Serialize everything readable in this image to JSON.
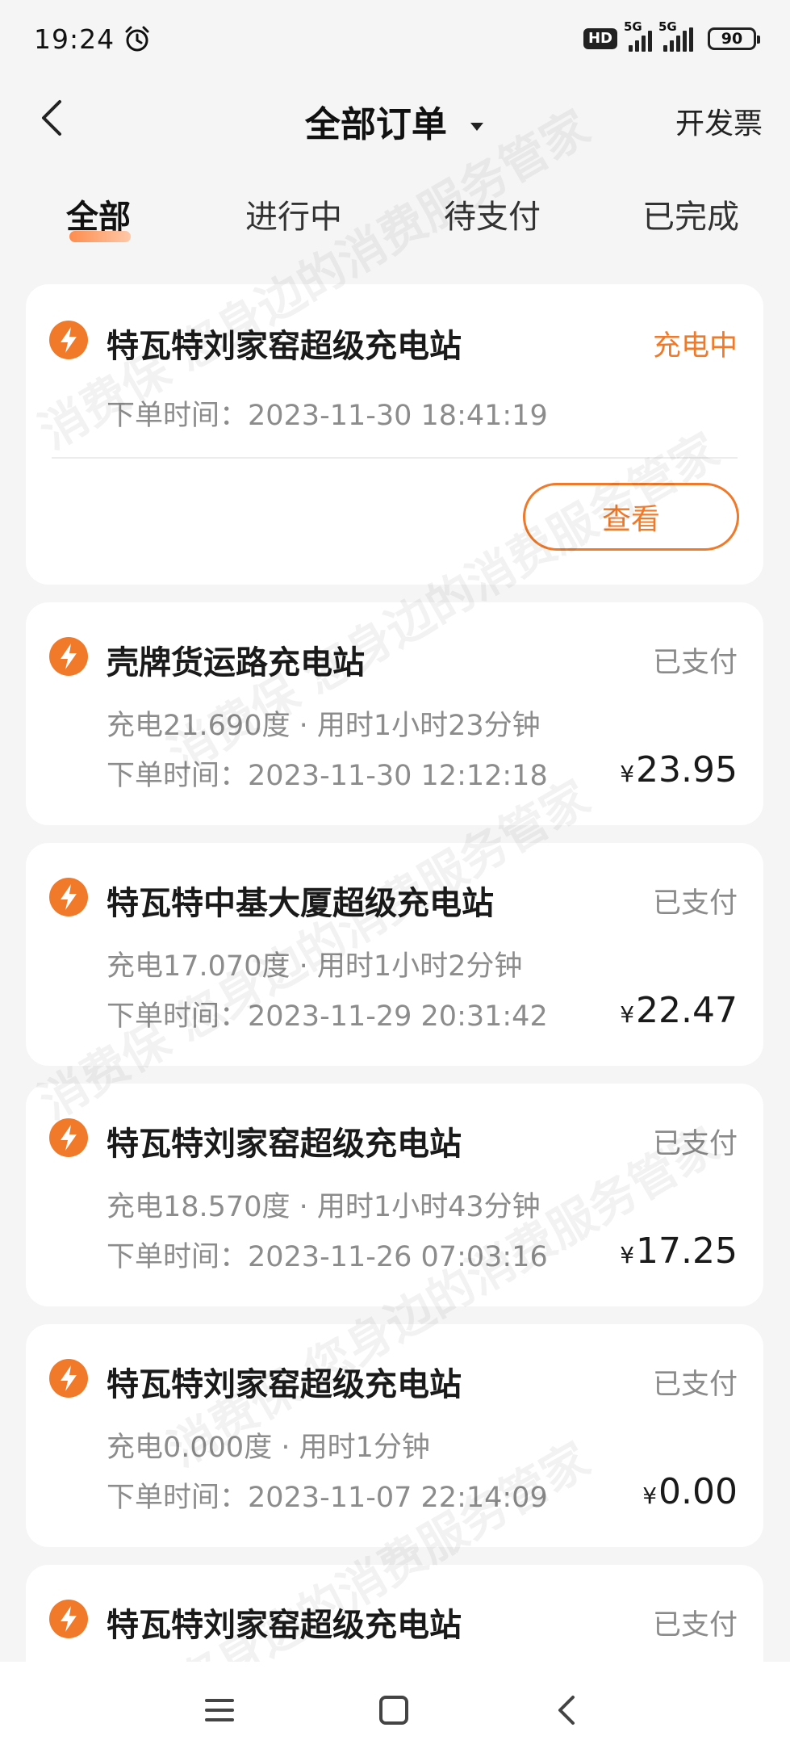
{
  "status_bar": {
    "time": "19:24",
    "hd": "HD",
    "net1": "5G",
    "net2": "5G",
    "battery": "90"
  },
  "header": {
    "title": "全部订单",
    "invoice": "开发票"
  },
  "tabs": [
    {
      "label": "全部"
    },
    {
      "label": "进行中"
    },
    {
      "label": "待支付"
    },
    {
      "label": "已完成"
    }
  ],
  "orders": [
    {
      "station": "特瓦特刘家窑超级充电站",
      "status": "充电中",
      "order_time": "下单时间：2023-11-30 18:41:19",
      "action": "查看"
    },
    {
      "station": "壳牌货运路充电站",
      "status": "已支付",
      "detail": "充电21.690度 · 用时1小时23分钟",
      "order_time": "下单时间：2023-11-30 12:12:18",
      "currency": "¥",
      "amount": "23.95"
    },
    {
      "station": "特瓦特中基大厦超级充电站",
      "status": "已支付",
      "detail": "充电17.070度 · 用时1小时2分钟",
      "order_time": "下单时间：2023-11-29 20:31:42",
      "currency": "¥",
      "amount": "22.47"
    },
    {
      "station": "特瓦特刘家窑超级充电站",
      "status": "已支付",
      "detail": "充电18.570度 · 用时1小时43分钟",
      "order_time": "下单时间：2023-11-26 07:03:16",
      "currency": "¥",
      "amount": "17.25"
    },
    {
      "station": "特瓦特刘家窑超级充电站",
      "status": "已支付",
      "detail": "充电0.000度 · 用时1分钟",
      "order_time": "下单时间：2023-11-07 22:14:09",
      "currency": "¥",
      "amount": "0.00"
    },
    {
      "station": "特瓦特刘家窑超级充电站",
      "status": "已支付"
    }
  ],
  "watermark": "消费保 您身边的消费服务管家",
  "colors": {
    "accent": "#f07a2a",
    "background": "#f5f5f5",
    "muted_text": "#8c8c8c"
  }
}
